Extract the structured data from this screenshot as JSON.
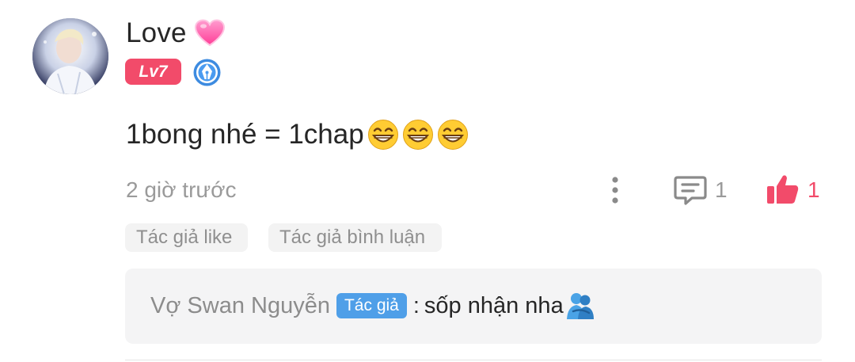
{
  "user": {
    "name": "Love",
    "level": "Lv7"
  },
  "comment": {
    "text": "1bong nhé = 1chap",
    "emojis": [
      "grinning-face",
      "grinning-face",
      "grinning-face"
    ],
    "time": "2 giờ trước",
    "reply_count": "1",
    "like_count": "1"
  },
  "tags": {
    "author_like": "Tác giả like",
    "author_comment": "Tác giả bình luận"
  },
  "reply": {
    "author": "Vợ Swan Nguyễn",
    "author_badge": "Tác giả",
    "separator": ":",
    "text": "sốp nhận nha"
  },
  "colors": {
    "accent": "#f24b6a",
    "author_badge": "#4f9fe8",
    "muted_text": "#9a9a9a"
  },
  "icons": {
    "name_suffix": "pink-heart-icon",
    "badge": "pen-nib-badge-icon",
    "more": "vertical-dots-icon",
    "reply": "comment-bubble-icon",
    "like": "thumbs-up-icon",
    "reply_emoji": "people-hugging-icon"
  }
}
